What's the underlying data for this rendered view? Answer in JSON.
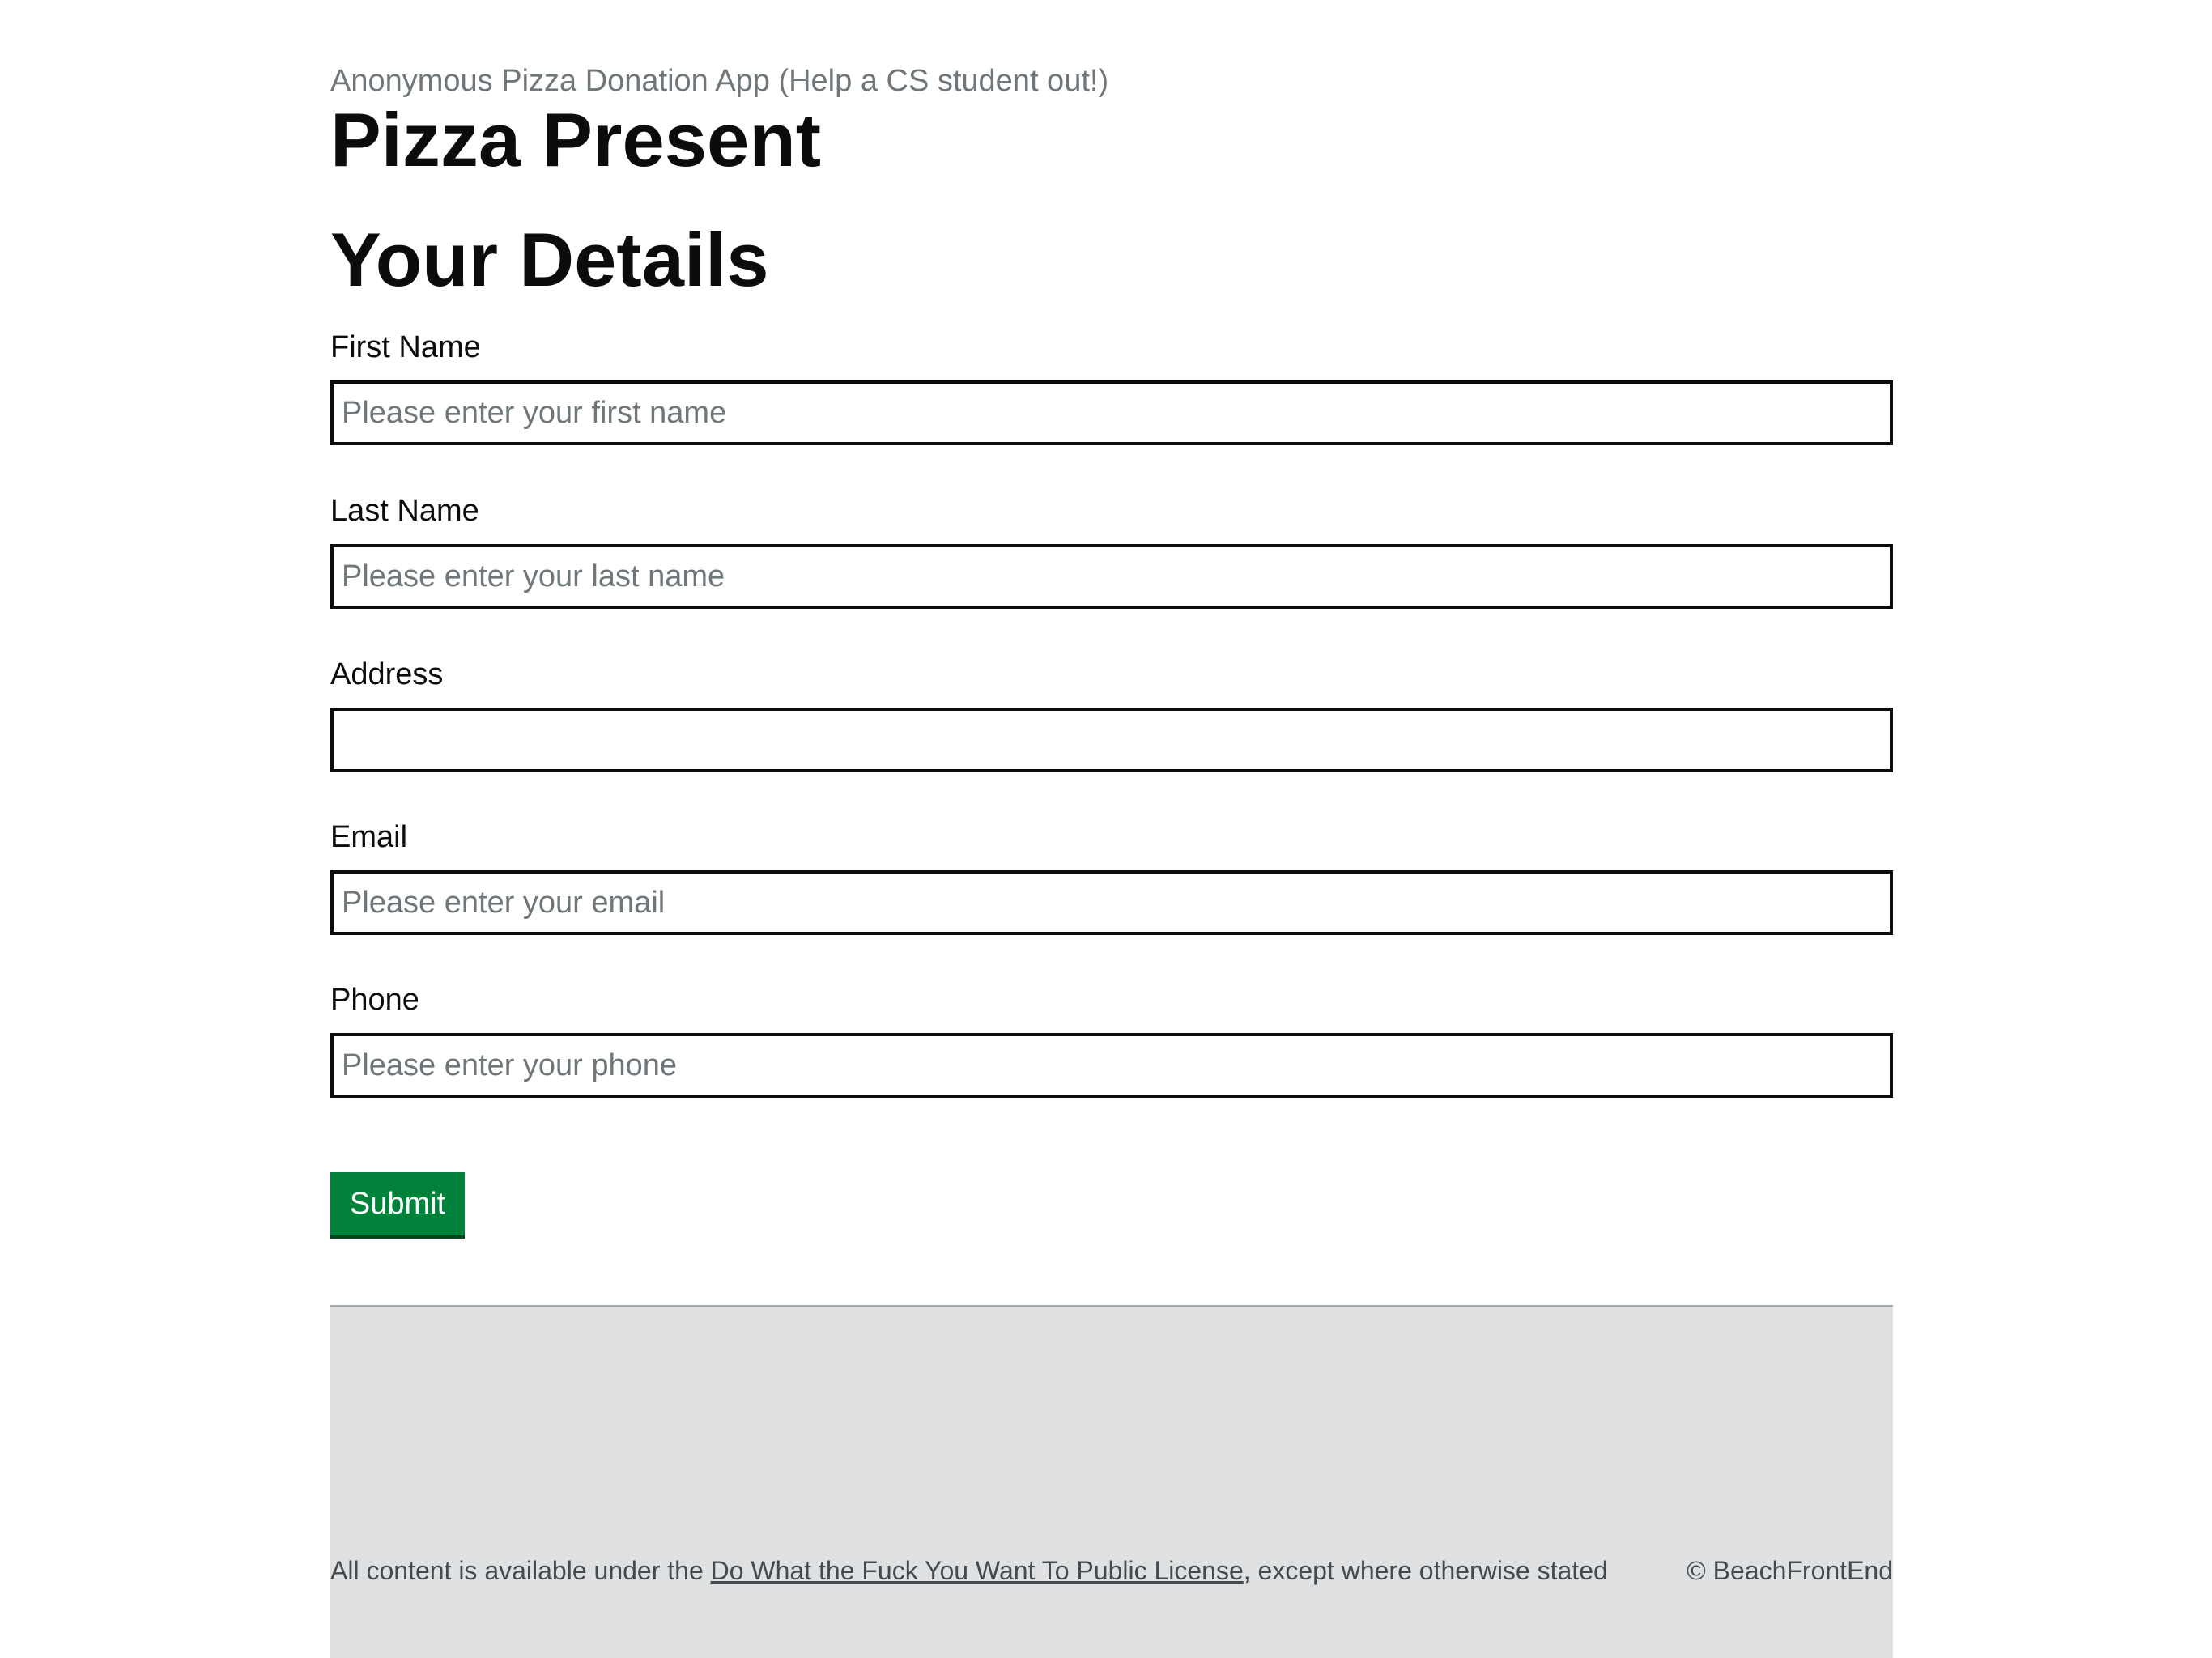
{
  "header": {
    "caption": "Anonymous Pizza Donation App (Help a CS student out!)",
    "title": "Pizza Present"
  },
  "form": {
    "section_title": "Your Details",
    "fields": [
      {
        "label": "First Name",
        "value": "",
        "placeholder": "Please enter your first name"
      },
      {
        "label": "Last Name",
        "value": "",
        "placeholder": "Please enter your last name"
      },
      {
        "label": "Address",
        "value": "",
        "placeholder": ""
      },
      {
        "label": "Email",
        "value": "",
        "placeholder": "Please enter your email"
      },
      {
        "label": "Phone",
        "value": "",
        "placeholder": "Please enter your phone"
      }
    ],
    "submit_label": "Submit"
  },
  "footer": {
    "license_prefix": "All content is available under the ",
    "license_link": "Do What the Fuck You Want To Public License",
    "license_suffix": ", except where otherwise stated",
    "copyright": "© BeachFrontEnd"
  },
  "colors": {
    "submit_button": "#00823b",
    "footer_background": "#dee0e2",
    "caption_text": "#6f777b"
  }
}
